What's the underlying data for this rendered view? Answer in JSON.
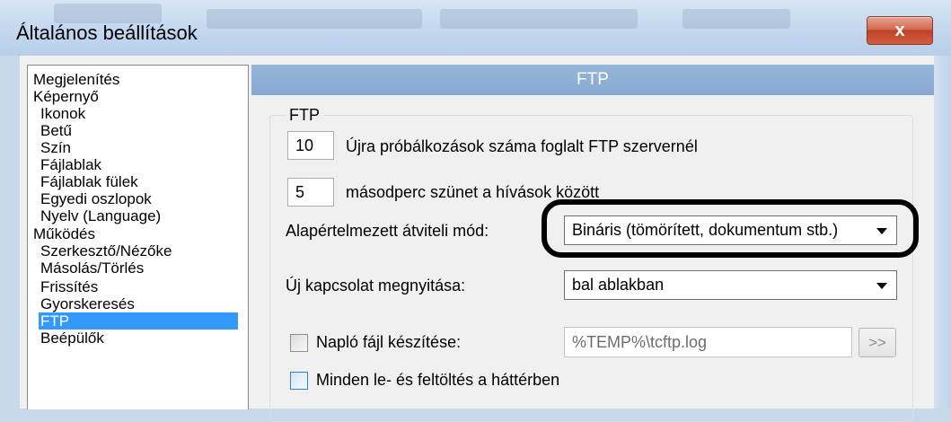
{
  "window": {
    "title": "Általános beállítások",
    "close_glyph": "x"
  },
  "tree": [
    {
      "label": "Megjelenítés",
      "level": 0
    },
    {
      "label": "Képernyő",
      "level": 0
    },
    {
      "label": "Ikonok",
      "level": 1
    },
    {
      "label": "Betű",
      "level": 1
    },
    {
      "label": "Szín",
      "level": 1
    },
    {
      "label": "Fájlablak",
      "level": 1
    },
    {
      "label": "Fájlablak fülek",
      "level": 1
    },
    {
      "label": "Egyedi oszlopok",
      "level": 1
    },
    {
      "label": "Nyelv (Language)",
      "level": 1
    },
    {
      "label": "Működés",
      "level": 0
    },
    {
      "label": "Szerkesztő/Nézőke",
      "level": 1
    },
    {
      "label": "Másolás/Törlés",
      "level": 1
    },
    {
      "label": "Frissítés",
      "level": 1
    },
    {
      "label": "Gyorskeresés",
      "level": 1
    },
    {
      "label": "FTP",
      "level": 1,
      "selected": true
    },
    {
      "label": "Beépülők",
      "level": 1
    }
  ],
  "panel": {
    "header": "FTP",
    "group_title": "FTP",
    "retries": {
      "value": "10",
      "label": "Újra próbálkozások száma foglalt FTP szervernél"
    },
    "delay": {
      "value": "5",
      "label": "másodperc szünet a hívások között"
    },
    "transfer_mode": {
      "label": "Alapértelmezett átviteli mód:",
      "value": "Bináris (tömörített, dokumentum stb.)"
    },
    "new_connection": {
      "label": "Új kapcsolat megnyitása:",
      "value": "bal ablakban"
    },
    "log_file": {
      "label": "Napló fájl készítése:",
      "path": "%TEMP%\\tcftp.log",
      "browse_label": ">>"
    },
    "background": {
      "label": "Minden le- és feltöltés a háttérben"
    }
  },
  "colors": {
    "selection": "#3399ff",
    "panel_header": "#8fafd4",
    "close_button": "#c7432a"
  }
}
